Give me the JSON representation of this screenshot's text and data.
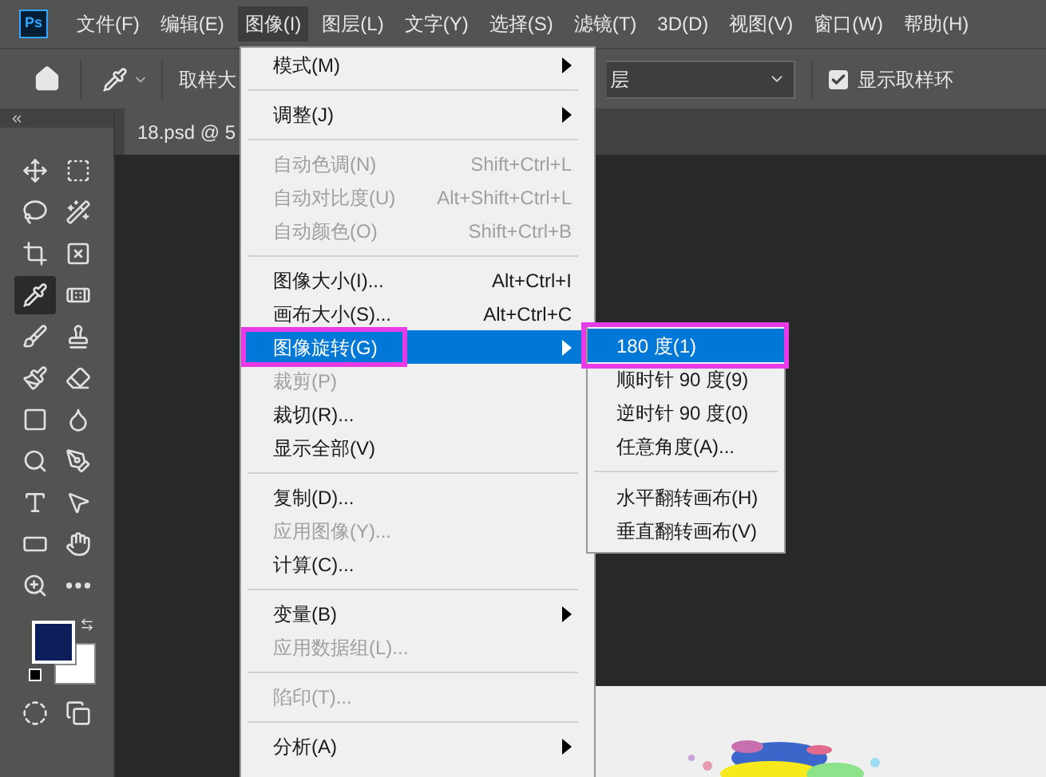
{
  "app_logo": "Ps",
  "menubar": [
    {
      "label": "文件(F)",
      "selected": false
    },
    {
      "label": "编辑(E)",
      "selected": false
    },
    {
      "label": "图像(I)",
      "selected": true
    },
    {
      "label": "图层(L)",
      "selected": false
    },
    {
      "label": "文字(Y)",
      "selected": false
    },
    {
      "label": "选择(S)",
      "selected": false
    },
    {
      "label": "滤镜(T)",
      "selected": false
    },
    {
      "label": "3D(D)",
      "selected": false
    },
    {
      "label": "视图(V)",
      "selected": false
    },
    {
      "label": "窗口(W)",
      "selected": false
    },
    {
      "label": "帮助(H)",
      "selected": false
    }
  ],
  "options_bar": {
    "sample_size_label": "取样大",
    "sample_dropdown_value": "层",
    "show_ring": {
      "label": "显示取样环",
      "checked": true
    }
  },
  "document_tab": {
    "title": "18.psd @ 5"
  },
  "tools": [
    {
      "selected": false
    },
    {
      "selected": false
    },
    {
      "selected": false
    },
    {
      "selected": false
    },
    {
      "selected": false
    },
    {
      "selected": false
    },
    {
      "selected": true
    },
    {
      "selected": false
    },
    {
      "selected": false
    },
    {
      "selected": false
    },
    {
      "selected": false
    },
    {
      "selected": false
    },
    {
      "selected": false
    },
    {
      "selected": false
    },
    {
      "selected": false
    },
    {
      "selected": false
    },
    {
      "selected": false
    },
    {
      "selected": false
    },
    {
      "selected": false
    },
    {
      "selected": false
    },
    {
      "selected": false
    },
    {
      "selected": false
    }
  ],
  "image_menu": [
    {
      "kind": "item",
      "label": "模式(M)",
      "submenu": true,
      "disabled": false,
      "selected": false
    },
    {
      "kind": "separator"
    },
    {
      "kind": "item",
      "label": "调整(J)",
      "submenu": true,
      "disabled": false,
      "selected": false
    },
    {
      "kind": "separator"
    },
    {
      "kind": "item",
      "label": "自动色调(N)",
      "shortcut": "Shift+Ctrl+L",
      "disabled": true,
      "selected": false
    },
    {
      "kind": "item",
      "label": "自动对比度(U)",
      "shortcut": "Alt+Shift+Ctrl+L",
      "disabled": true,
      "selected": false
    },
    {
      "kind": "item",
      "label": "自动颜色(O)",
      "shortcut": "Shift+Ctrl+B",
      "disabled": true,
      "selected": false
    },
    {
      "kind": "separator"
    },
    {
      "kind": "item",
      "label": "图像大小(I)...",
      "shortcut": "Alt+Ctrl+I",
      "disabled": false,
      "selected": false
    },
    {
      "kind": "item",
      "label": "画布大小(S)...",
      "shortcut": "Alt+Ctrl+C",
      "disabled": false,
      "selected": false
    },
    {
      "kind": "item",
      "label": "图像旋转(G)",
      "submenu": true,
      "selected": true,
      "annotated": true
    },
    {
      "kind": "item",
      "label": "裁剪(P)",
      "disabled": true,
      "selected": false
    },
    {
      "kind": "item",
      "label": "裁切(R)...",
      "disabled": false,
      "selected": false
    },
    {
      "kind": "item",
      "label": "显示全部(V)",
      "disabled": false,
      "selected": false
    },
    {
      "kind": "separator"
    },
    {
      "kind": "item",
      "label": "复制(D)...",
      "disabled": false,
      "selected": false
    },
    {
      "kind": "item",
      "label": "应用图像(Y)...",
      "disabled": true,
      "selected": false
    },
    {
      "kind": "item",
      "label": "计算(C)...",
      "disabled": false,
      "selected": false
    },
    {
      "kind": "separator"
    },
    {
      "kind": "item",
      "label": "变量(B)",
      "submenu": true,
      "disabled": false,
      "selected": false
    },
    {
      "kind": "item",
      "label": "应用数据组(L)...",
      "disabled": true,
      "selected": false
    },
    {
      "kind": "separator"
    },
    {
      "kind": "item",
      "label": "陷印(T)...",
      "disabled": true,
      "selected": false
    },
    {
      "kind": "separator"
    },
    {
      "kind": "item",
      "label": "分析(A)",
      "submenu": true,
      "disabled": false,
      "selected": false
    }
  ],
  "rotate_submenu": [
    {
      "kind": "item",
      "label": "180 度(1)",
      "selected": true,
      "annotated": true
    },
    {
      "kind": "item",
      "label": "顺时针 90 度(9)",
      "selected": false
    },
    {
      "kind": "item",
      "label": "逆时针 90 度(0)",
      "selected": false
    },
    {
      "kind": "item",
      "label": "任意角度(A)...",
      "selected": false
    },
    {
      "kind": "separator"
    },
    {
      "kind": "item",
      "label": "水平翻转画布(H)",
      "selected": false
    },
    {
      "kind": "item",
      "label": "垂直翻转画布(V)",
      "selected": false
    }
  ]
}
